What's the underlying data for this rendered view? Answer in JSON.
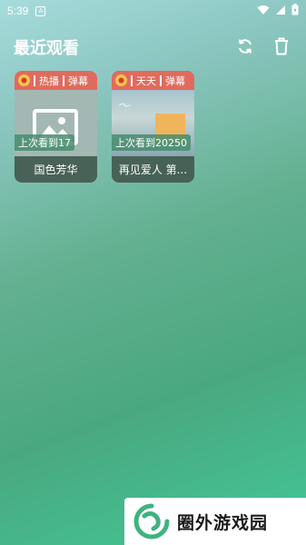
{
  "status": {
    "time": "5:39",
    "noti_glyph": "A"
  },
  "header": {
    "title": "最近观看",
    "sync_icon": "sync-icon",
    "delete_icon": "trash-icon"
  },
  "items": [
    {
      "tag_source": "热播",
      "tag_danmaku": "弹幕",
      "progress": "上次看到17",
      "name": "国色芳华"
    },
    {
      "tag_source": "天天",
      "tag_danmaku": "弹幕",
      "progress": "上次看到20250",
      "name": "再见爱人 第..."
    }
  ],
  "watermark": {
    "text": "圈外游戏园"
  },
  "colors": {
    "tag_bg": "#e06b5d",
    "accent": "#42c898"
  }
}
